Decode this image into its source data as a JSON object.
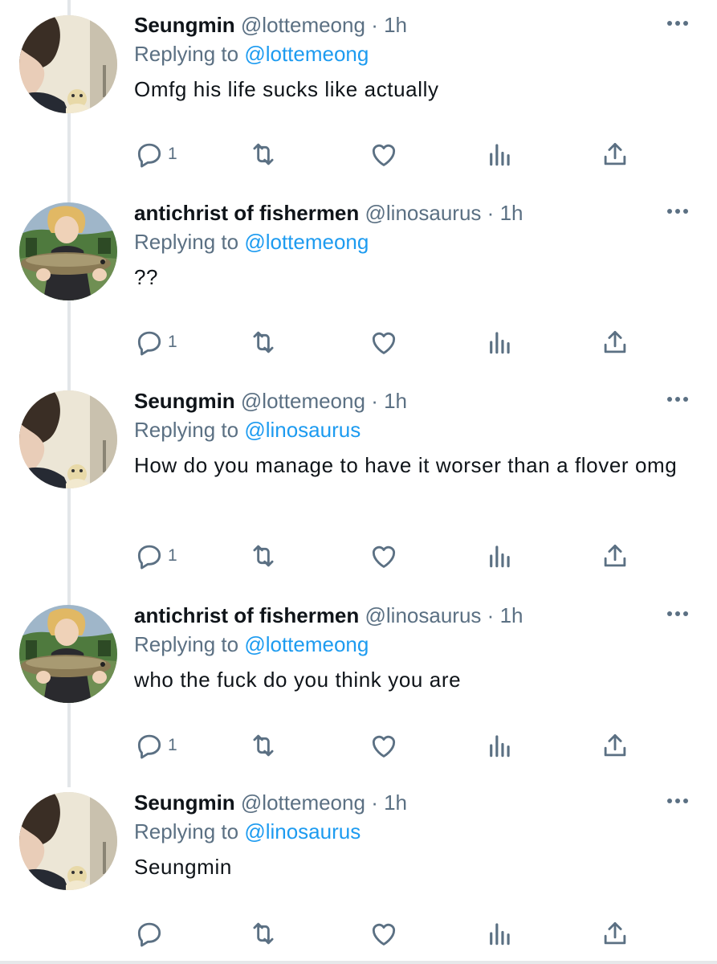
{
  "tweets": [
    {
      "name": "Seungmin",
      "handle": "@lottemeong",
      "dot": "·",
      "time": "1h",
      "replying_label": "Replying to",
      "replying_to": "@lottemeong",
      "text": "Omfg his life sucks like actually",
      "reply_count": "1",
      "avatar": "seungmin-avatar"
    },
    {
      "name": "antichrist of fishermen",
      "handle": "@linosaurus",
      "dot": "·",
      "time": "1h",
      "replying_label": "Replying to",
      "replying_to": "@lottemeong",
      "text": "??",
      "reply_count": "1",
      "avatar": "fish-avatar"
    },
    {
      "name": "Seungmin",
      "handle": "@lottemeong",
      "dot": "·",
      "time": "1h",
      "replying_label": "Replying to",
      "replying_to": "@linosaurus",
      "text": "How do you manage to have it worser than a flover omg",
      "reply_count": "1",
      "avatar": "seungmin-avatar"
    },
    {
      "name": "antichrist of fishermen",
      "handle": "@linosaurus",
      "dot": "·",
      "time": "1h",
      "replying_label": "Replying to",
      "replying_to": "@lottemeong",
      "text": "who the fuck do you think you are",
      "reply_count": "1",
      "avatar": "fish-avatar"
    },
    {
      "name": "Seungmin",
      "handle": "@lottemeong",
      "dot": "·",
      "time": "1h",
      "replying_label": "Replying to",
      "replying_to": "@linosaurus",
      "text": "Seungmin",
      "reply_count": "",
      "avatar": "seungmin-avatar"
    }
  ],
  "colors": {
    "name": "#0f1419",
    "meta": "#5b7083",
    "mention": "#1d9bf0",
    "thread_line": "#e3e6e9"
  },
  "icons": [
    "reply-icon",
    "retweet-icon",
    "like-icon",
    "stats-icon",
    "share-icon",
    "more-icon"
  ]
}
